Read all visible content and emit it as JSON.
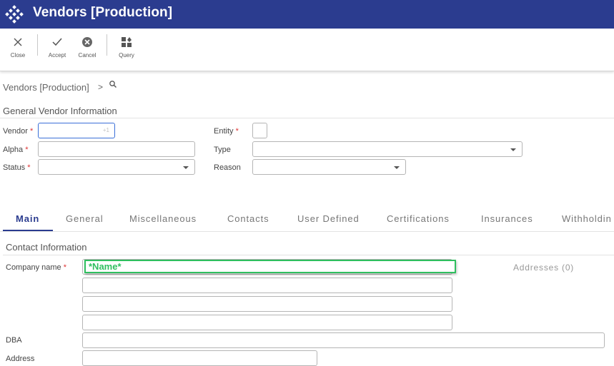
{
  "window": {
    "title": "Vendors [Production]"
  },
  "toolbar": {
    "close_label": "Close",
    "accept_label": "Accept",
    "cancel_label": "Cancel",
    "query_label": "Query"
  },
  "breadcrumb": {
    "text": "Vendors [Production]",
    "separator": ">"
  },
  "general": {
    "title": "General Vendor Information",
    "vendor_label": "Vendor",
    "vendor_value": "",
    "vendor_hint": "+1",
    "alpha_label": "Alpha",
    "alpha_value": "",
    "status_label": "Status",
    "status_value": "",
    "entity_label": "Entity",
    "entity_value": "",
    "type_label": "Type",
    "type_value": "",
    "reason_label": "Reason",
    "reason_value": "",
    "required_mark": "*"
  },
  "tabs": [
    "Main",
    "General",
    "Miscellaneous",
    "Contacts",
    "User Defined",
    "Certifications",
    "Insurances",
    "Withholdin"
  ],
  "contact": {
    "title": "Contact Information",
    "company_label": "Company name",
    "company_value": "*Name*",
    "dba_label": "DBA",
    "address_label": "Address",
    "addresses_link": "Addresses (0)"
  },
  "colors": {
    "brand": "#2b3c8f",
    "highlight": "#2fbf5f",
    "required": "#dd3333"
  }
}
